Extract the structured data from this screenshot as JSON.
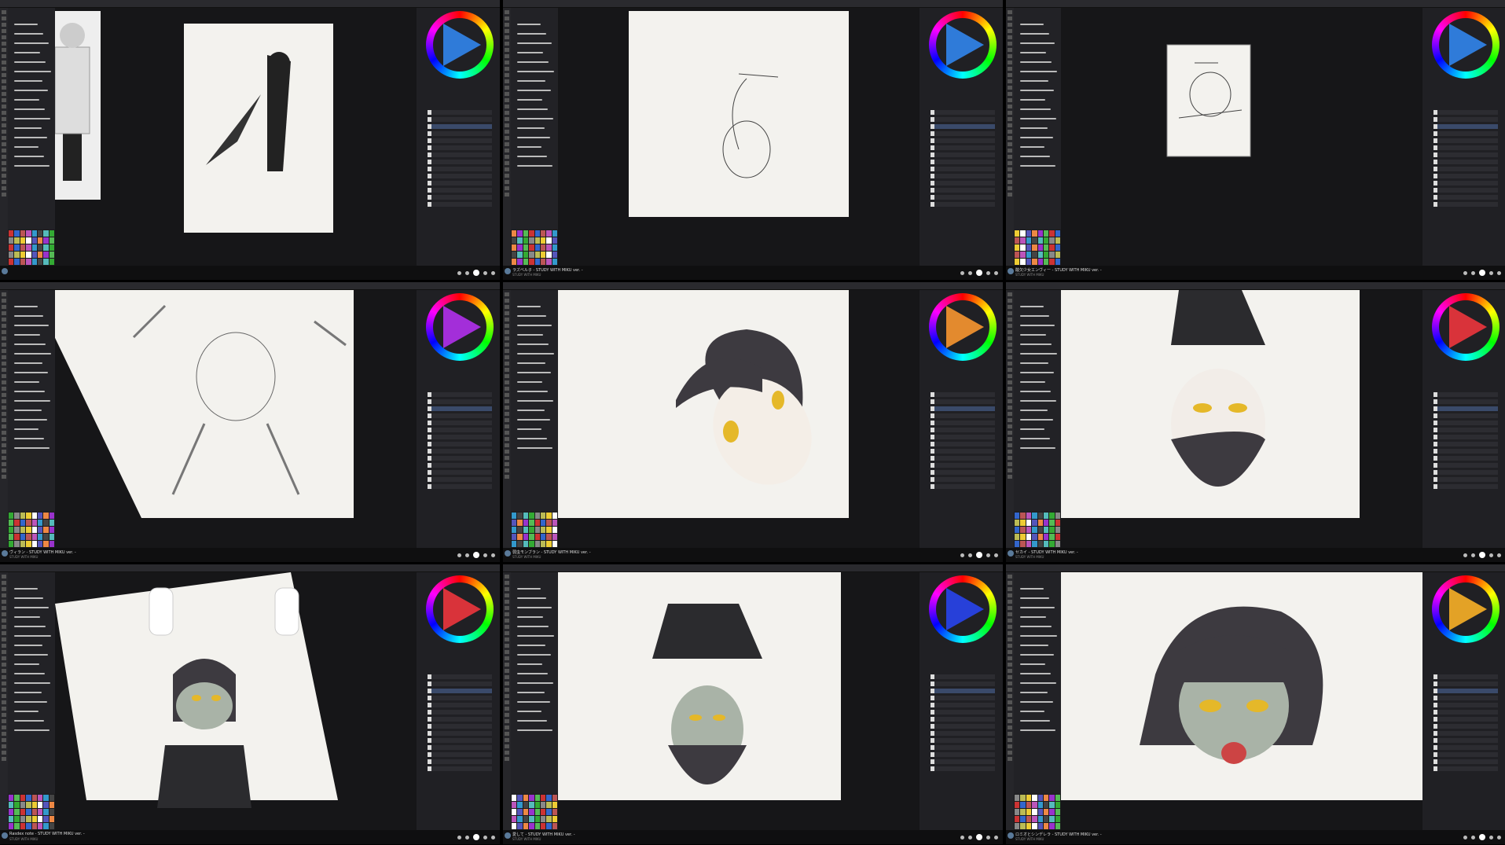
{
  "colors": {
    "background": "#000000",
    "app_bg": "#1b1b1d",
    "panel": "#202024",
    "paper": "#f3f2ee",
    "hair": "#3d3a40",
    "eyes": "#e5b829"
  },
  "icons": [
    "menu-icon",
    "brush-icon",
    "color-wheel-icon",
    "layer-icon",
    "play-icon",
    "pause-icon",
    "skip-icon",
    "settings-icon"
  ],
  "cells": [
    {
      "id": "c1",
      "title": "",
      "sub": "",
      "wheel_tri": "#2f7bd9"
    },
    {
      "id": "c2",
      "title": "ラズベル子 - STUDY WITH MIKU ver. -",
      "sub": "STUDY WITH MIKU",
      "wheel_tri": "#2f7bd9"
    },
    {
      "id": "c3",
      "title": "酸欠少女エンヴィー - STUDY WITH MIKU ver. -",
      "sub": "STUDY WITH MIKU",
      "wheel_tri": "#2f7bd9"
    },
    {
      "id": "c4",
      "title": "ヴィラン - STUDY WITH MIKU ver. -",
      "sub": "STUDY WITH MIKU",
      "wheel_tri": "#a32ed9"
    },
    {
      "id": "c5",
      "title": "弱虫モンブラン - STUDY WITH MIKU ver. -",
      "sub": "STUDY WITH MIKU",
      "wheel_tri": "#e38a2e"
    },
    {
      "id": "c6",
      "title": "セカイ - STUDY WITH MIKU ver. -",
      "sub": "STUDY WITH MIKU",
      "wheel_tri": "#d9333a"
    },
    {
      "id": "c7",
      "title": "Rasdex note - STUDY WITH MIKU ver. -",
      "sub": "STUDY WITH MIKU",
      "wheel_tri": "#d9333a"
    },
    {
      "id": "c8",
      "title": "愛して - STUDY WITH MIKU ver. -",
      "sub": "STUDY WITH MIKU",
      "wheel_tri": "#2740d9"
    },
    {
      "id": "c9",
      "title": "ロミオとシンデレラ - STUDY WITH MIKU ver. -",
      "sub": "STUDY WITH MIKU",
      "wheel_tri": "#e3a226"
    }
  ]
}
